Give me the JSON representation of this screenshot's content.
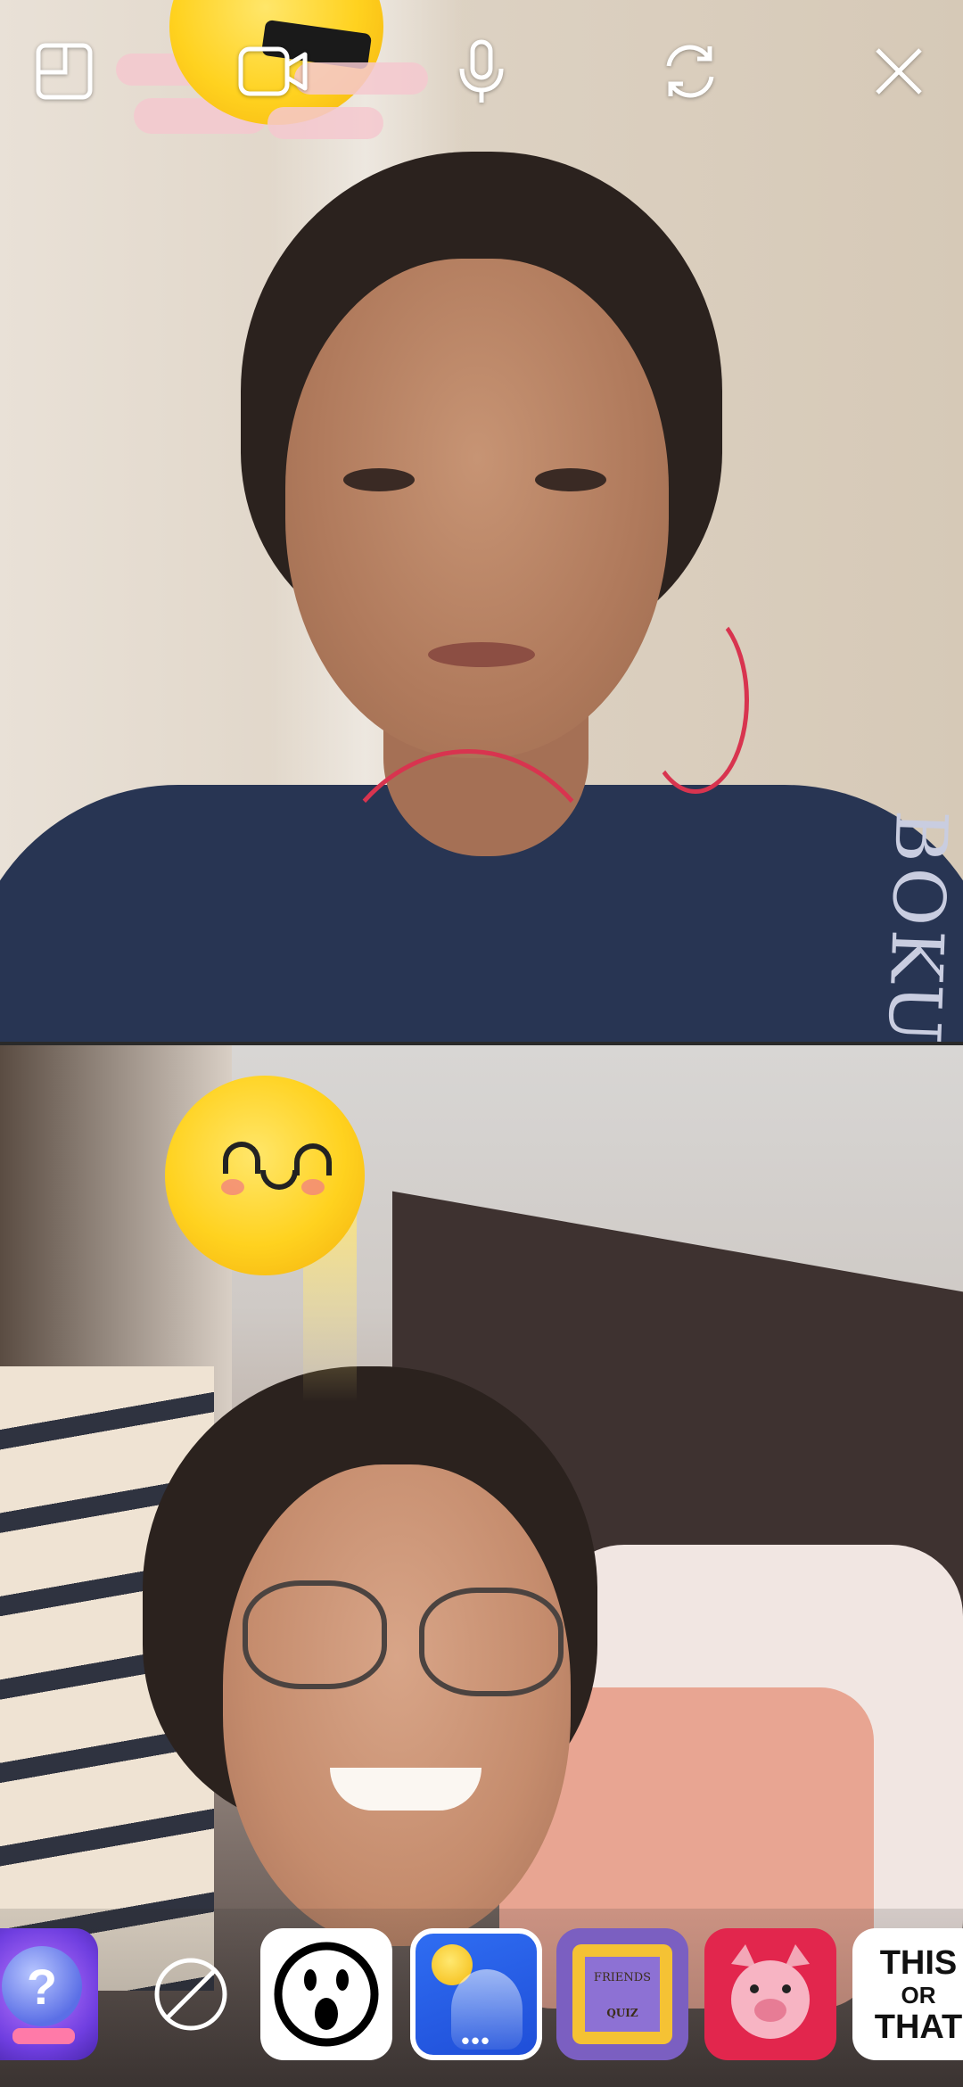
{
  "toolbar": {
    "buttons": [
      {
        "name": "layout-toggle-button",
        "icon": "layout-icon"
      },
      {
        "name": "video-toggle-button",
        "icon": "video-camera-icon"
      },
      {
        "name": "mic-toggle-button",
        "icon": "microphone-icon"
      },
      {
        "name": "flip-camera-button",
        "icon": "flip-camera-icon"
      },
      {
        "name": "close-call-button",
        "icon": "close-icon"
      }
    ]
  },
  "participants": [
    {
      "position": "top",
      "effect": "sun-with-sunglasses-sticker",
      "shirt_text": "BOKU"
    },
    {
      "position": "bottom",
      "effect": "smiling-bubble-sticker"
    }
  ],
  "effects_tray": {
    "items": [
      {
        "name": "crystal-ball-effect",
        "icon": "crystal-ball-question-icon",
        "glyph": "?"
      },
      {
        "name": "no-effect",
        "icon": "no-effect-icon"
      },
      {
        "name": "surprised-face-effect",
        "icon": "surprised-face-icon"
      },
      {
        "name": "bubble-sun-effect",
        "icon": "bubble-sun-icon",
        "selected": true,
        "more": "•••"
      },
      {
        "name": "friends-quiz-effect",
        "icon": "picture-frame-icon",
        "title": "FRIENDS",
        "subtitle": "QUIZ"
      },
      {
        "name": "pig-face-effect",
        "icon": "pig-face-icon"
      },
      {
        "name": "this-or-that-effect",
        "icon": "this-or-that-icon",
        "line1": "THIS",
        "line2": "OR",
        "line3": "THAT"
      }
    ]
  },
  "colors": {
    "tray_selected_border": "#ffffff",
    "icon_color": "#ffffff",
    "earphone": "#d8344f"
  }
}
